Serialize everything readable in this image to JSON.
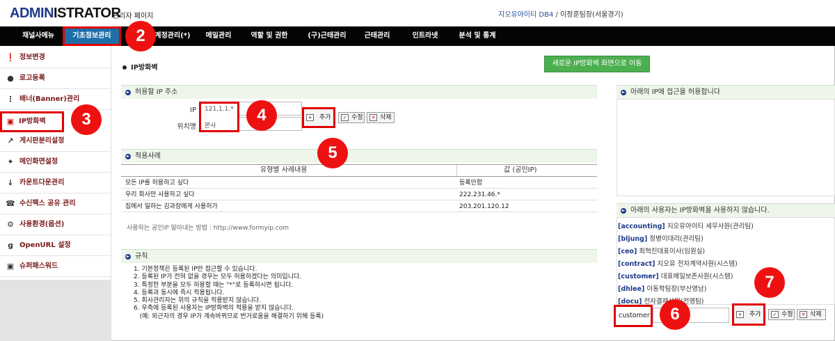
{
  "header": {
    "logo_brand": "ADMIN",
    "logo_rest": "ISTRATOR",
    "logo_sub": "관리자 페이지",
    "company": "지오유아이티 DB4",
    "separator": " / ",
    "user": "이정훈팀장(서울경기)"
  },
  "nav": {
    "items": [
      "채널사메뉴",
      "기초정보관리",
      "계정관리(*)",
      "메일관리",
      "역할 및 권한",
      "(구)근태관리",
      "근태관리",
      "인트라넷",
      "분석 및 통계"
    ]
  },
  "sidebar": {
    "items": [
      {
        "label": "정보변경",
        "icon": "info-icon"
      },
      {
        "label": "로고등록",
        "icon": "apple-icon"
      },
      {
        "label": "배너(Banner)관리",
        "icon": "spinner-icon"
      },
      {
        "label": "IP방화벽",
        "icon": "lock-icon"
      },
      {
        "label": "게시판분리설정",
        "icon": "external-link-icon"
      },
      {
        "label": "메인화면설정",
        "icon": "puzzle-icon"
      },
      {
        "label": "카운트다운관리",
        "icon": "sort-numeric-icon"
      },
      {
        "label": "수신팩스 공유 관리",
        "icon": "phone-icon"
      },
      {
        "label": "사용환경(옵션)",
        "icon": "gear-icon"
      },
      {
        "label": "OpenURL 설정",
        "icon": "git-icon"
      },
      {
        "label": "슈퍼패스워드",
        "icon": "lock-icon"
      }
    ]
  },
  "main": {
    "title": "IP방화벽",
    "goto_new_button": "새로운 IP방화벽 화면으로 이동",
    "allow_section": {
      "heading": "허용할 IP 주소",
      "ip_label": "IP",
      "ip_value": "121.1.1.*",
      "location_label": "위치명",
      "location_value": "본사",
      "add_button": "추가",
      "edit_button": "수정",
      "delete_button": "삭제"
    },
    "examples": {
      "heading": "적용사례",
      "col1": "유형별 사례내용",
      "col2": "값 (공인IP)",
      "rows": [
        {
          "case": "모든 IP를 허용하고 싶다",
          "value": "등록안함"
        },
        {
          "case": "우리 회사만 사용하고 싶다",
          "value": "222.231.46.*"
        },
        {
          "case": "집에서 일하는 김과장에게 사용허가",
          "value": "203.201.120.12"
        }
      ],
      "note": "사용하는 공인IP 알아내는 방법 : http://www.formyip.com"
    },
    "rules": {
      "heading": "규칙",
      "lines": [
        "1. 기본정책은 등록된 IP만 접근할 수 있습니다.",
        "2. 등록된 IP가 전혀 없을 경우는 모두 허용하겠다는 의미입니다.",
        "3. 특정한 부분을 모두 허용할 때는 \"*\"로 등록하시면 됩니다.",
        "4. 등록과 동시에 즉시 적용됩니다.",
        "5. 회사관리자는 위의 규칙을 적용받지 않습니다.",
        "6. 우측에 등록된 사용자는 IP방화벽의 적용을 받지 않습니다.",
        "   (예: 외근자의 경우 IP가 계속바뀌므로 번거로움을 해결하기 위해 등록)"
      ]
    }
  },
  "right": {
    "allowed_heading": "아래의 IP에 접근을 허용합니다",
    "exempt_heading": "아래의 사용자는 IP방화벽을 사용하지 않습니다.",
    "users": [
      {
        "id": "[accounting]",
        "name": "지오유아이티 세무사원(관리팀)"
      },
      {
        "id": "[bljung]",
        "name": "정병이대리(관리팀)"
      },
      {
        "id": "[ceo]",
        "name": "최혁진대표이사(임원실)"
      },
      {
        "id": "[contract]",
        "name": "지오유 전자계약사원(시스템)"
      },
      {
        "id": "[customer]",
        "name": "대표메일보존사원(시스템)"
      },
      {
        "id": "[dhlee]",
        "name": "이동학팀장(부산영남)"
      },
      {
        "id": "[docu]",
        "name": "전자결재사원(전영팀)"
      }
    ],
    "user_input_value": "customer",
    "add_button": "추가",
    "edit_button": "수정",
    "delete_button": "삭제"
  },
  "badges": [
    "2",
    "3",
    "4",
    "5",
    "6",
    "7"
  ],
  "colors": {
    "highlight": "#e00000",
    "nav_bg": "#050505",
    "active_nav": "#1e6fa8",
    "green_button": "#4caf50",
    "badge": "#ee1111"
  }
}
